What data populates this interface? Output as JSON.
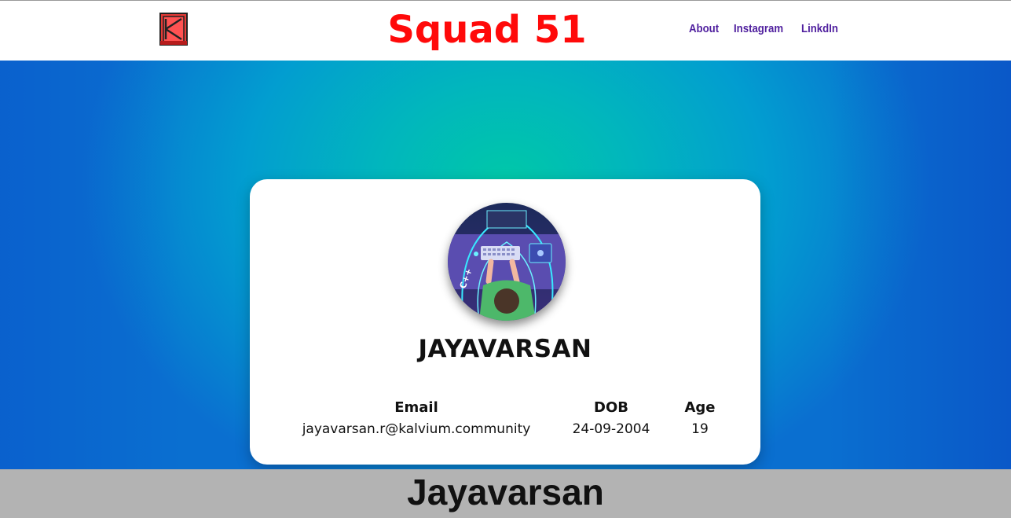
{
  "header": {
    "brand": "Squad 51",
    "logo_icon": "kalvium-logo-icon",
    "nav": [
      {
        "label": "About"
      },
      {
        "label": "Instagram"
      },
      {
        "label": "LinkdIn"
      }
    ]
  },
  "profile": {
    "avatar_icon": "coder-avatar-image",
    "name": "JAYAVARSAN",
    "fields": {
      "email_label": "Email",
      "email_value": "jayavarsan.r@kalvium.community",
      "dob_label": "DOB",
      "dob_value": "24-09-2004",
      "age_label": "Age",
      "age_value": "19"
    }
  },
  "footer": {
    "name": "Jayavarsan"
  },
  "colors": {
    "brand": "#ff0a0a",
    "nav": "#4f1f9e",
    "footer_bg": "#b3b3b3",
    "hero_center": "#00c8a8",
    "hero_edge": "#0a6fd0"
  }
}
